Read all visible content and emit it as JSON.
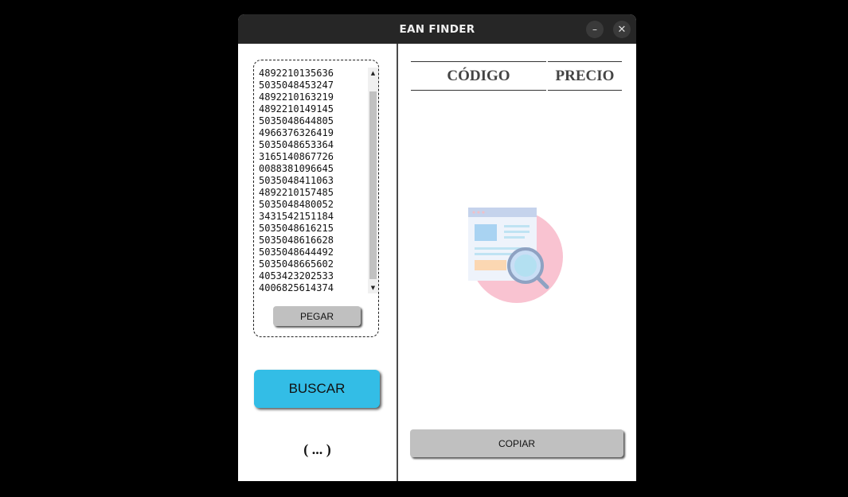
{
  "window": {
    "title": "EAN FINDER",
    "minimize_label": "–",
    "close_label": "✕"
  },
  "input": {
    "codes": [
      "4892210135636",
      "5035048453247",
      "4892210163219",
      "4892210149145",
      "5035048644805",
      "4966376326419",
      "5035048653364",
      "3165140867726",
      "0088381096645",
      "5035048411063",
      "4892210157485",
      "5035048480052",
      "3431542151184",
      "5035048616215",
      "5035048616628",
      "5035048644492",
      "5035048665602",
      "4053423202533",
      "4006825614374"
    ],
    "paste_label": "PEGAR"
  },
  "search": {
    "label": "BUSCAR",
    "color": "#33bde6"
  },
  "status": {
    "text": "( ... )"
  },
  "results": {
    "columns": [
      "CÓDIGO",
      "PRECIO"
    ],
    "empty_state_icon": "search-document-icon",
    "copy_label": "COPIAR"
  }
}
